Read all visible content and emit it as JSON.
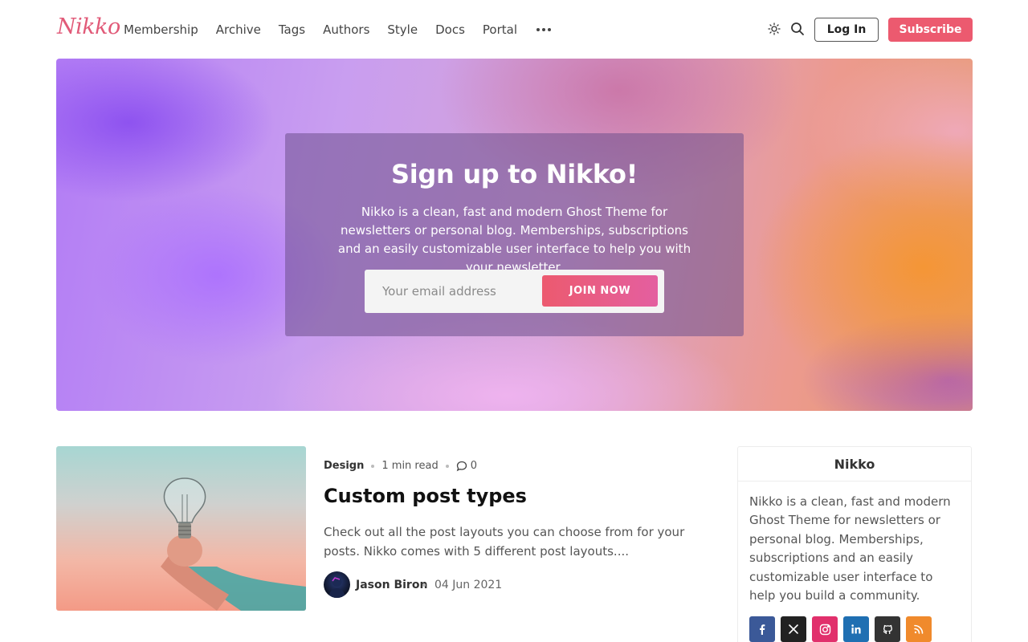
{
  "header": {
    "logo": "Nikko",
    "nav": [
      "Membership",
      "Archive",
      "Tags",
      "Authors",
      "Style",
      "Docs",
      "Portal"
    ],
    "more_icon": "more-horizontal-icon",
    "theme_icon": "sun-icon",
    "search_icon": "search-icon",
    "login_label": "Log In",
    "subscribe_label": "Subscribe"
  },
  "hero": {
    "title": "Sign up to Nikko!",
    "description": "Nikko is a clean, fast and modern Ghost Theme for newsletters or personal blog. Memberships, subscriptions and an easily customizable user interface to help you with your newsletter.",
    "email_placeholder": "Your email address",
    "join_label": "JOIN NOW"
  },
  "post": {
    "tag": "Design",
    "read_time": "1 min read",
    "comments": "0",
    "title": "Custom post types",
    "excerpt": "Check out all the post layouts you can choose from for your posts. Nikko comes with 5 different post layouts....",
    "author": "Jason Biron",
    "date": "04 Jun 2021"
  },
  "sidebar": {
    "title": "Nikko",
    "text": "Nikko is a clean, fast and modern Ghost Theme for newsletters or personal blog. Memberships, subscriptions and an easily customizable user interface to help you build a community.",
    "socials": [
      {
        "icon": "facebook-icon",
        "color": "#3b5998"
      },
      {
        "icon": "x-icon",
        "color": "#222222"
      },
      {
        "icon": "instagram-icon",
        "color": "#e1306c"
      },
      {
        "icon": "linkedin-icon",
        "color": "#1f6fb2"
      },
      {
        "icon": "github-icon",
        "color": "#333333"
      },
      {
        "icon": "rss-icon",
        "color": "#f08a2c"
      }
    ]
  },
  "colors": {
    "accent": "#ec5a6f",
    "logo": "#e15a78"
  }
}
